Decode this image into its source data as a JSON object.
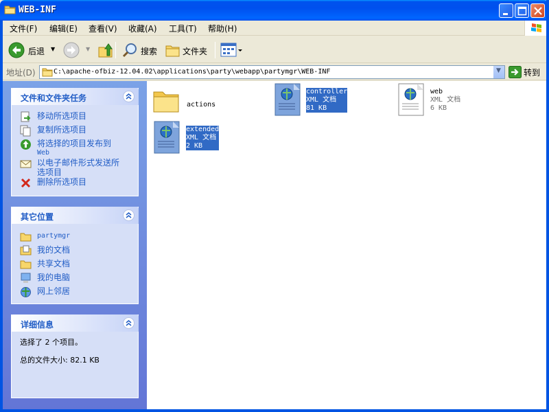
{
  "window": {
    "title": "WEB-INF",
    "controls": {
      "minimize_icon": "minimize-icon",
      "maximize_icon": "maximize-icon",
      "close_icon": "close-icon"
    }
  },
  "menu": [
    "文件(F)",
    "编辑(E)",
    "查看(V)",
    "收藏(A)",
    "工具(T)",
    "帮助(H)"
  ],
  "toolbar": {
    "back_label": "后退",
    "search_label": "搜索",
    "folders_label": "文件夹"
  },
  "address": {
    "label": "地址(D)",
    "path": "C:\\apache-ofbiz-12.04.02\\applications\\party\\webapp\\partymgr\\WEB-INF",
    "go_label": "转到"
  },
  "taskpane": {
    "file_tasks": {
      "title": "文件和文件夹任务",
      "items": [
        {
          "label": "移动所选项目",
          "icon": "move-icon"
        },
        {
          "label": "复制所选项目",
          "icon": "copy-icon"
        },
        {
          "label": "将选择的项目发布到",
          "label2": "Web",
          "icon": "publish-web-icon"
        },
        {
          "label": "以电子邮件形式发送所",
          "label2": "选项目",
          "icon": "email-icon"
        },
        {
          "label": "删除所选项目",
          "icon": "delete-icon"
        }
      ]
    },
    "other_places": {
      "title": "其它位置",
      "items": [
        {
          "label": "partymgr",
          "icon": "folder-icon"
        },
        {
          "label": "我的文档",
          "icon": "my-documents-icon"
        },
        {
          "label": "共享文档",
          "icon": "shared-documents-icon"
        },
        {
          "label": "我的电脑",
          "icon": "my-computer-icon"
        },
        {
          "label": "网上邻居",
          "icon": "network-places-icon"
        }
      ]
    },
    "details": {
      "title": "详细信息",
      "selected_text": "选择了 2 个项目。",
      "total_size_text": "总的文件大小: 82.1 KB"
    }
  },
  "files": [
    {
      "name": "actions",
      "type": "",
      "size": "",
      "kind": "folder",
      "selected": false
    },
    {
      "name": "controller",
      "type": "XML 文档",
      "size": "81 KB",
      "kind": "xml",
      "selected": true
    },
    {
      "name": "web",
      "type": "XML 文档",
      "size": "6 KB",
      "kind": "xml",
      "selected": false
    },
    {
      "name": "extended",
      "type": "XML 文档",
      "size": "2 KB",
      "kind": "xml",
      "selected": true
    }
  ],
  "colors": {
    "titlebar": "#0054e3",
    "selection": "#316ac5",
    "task_link": "#215dc6",
    "taskpane_bg": "#7ba2e7"
  }
}
